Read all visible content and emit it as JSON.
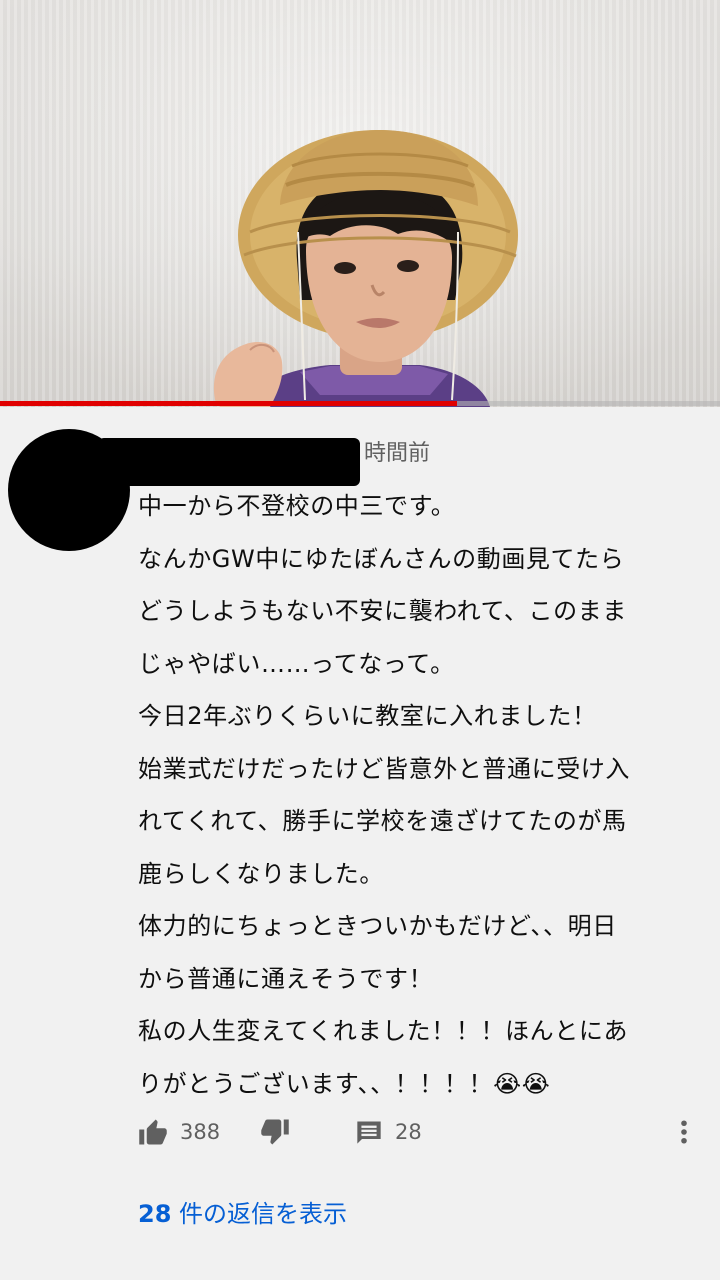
{
  "video": {
    "progress_fraction": 0.635
  },
  "comment": {
    "timestamp": "時間前",
    "lines": [
      "中一から不登校の中三です。",
      "なんかGW中にゆたぼんさんの動画見てたら",
      "どうしようもない不安に襲われて、このまま",
      "じゃやばい……ってなって。",
      "今日2年ぶりくらいに教室に入れました！",
      "始業式だけだったけど皆意外と普通に受け入",
      "れてくれて、勝手に学校を遠ざけてたのが馬",
      "鹿らしくなりました。",
      "体力的にちょっときついかもだけど、、明日",
      "から普通に通えそうです！",
      "私の人生変えてくれました！！！ほんとにあ",
      "りがとうございます、、！！！！😭😭"
    ],
    "likes": "388",
    "reply_count": "28",
    "view_replies": {
      "count": "28",
      "text": " 件の返信を表示"
    }
  },
  "icons": {
    "like": "thumbs-up-icon",
    "dislike": "thumbs-down-icon",
    "reply": "comment-icon",
    "more": "more-vertical-icon"
  },
  "colors": {
    "progress": "#e00000",
    "link": "#065fd4",
    "secondary_text": "#606060"
  }
}
